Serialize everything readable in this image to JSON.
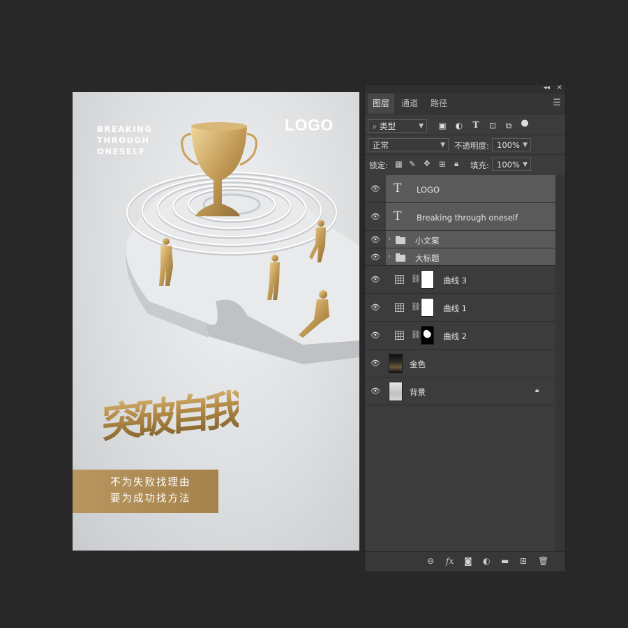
{
  "poster": {
    "en_slogan": [
      "BREAKING",
      "THROUGH",
      "ONESELF"
    ],
    "logo": "LOGO",
    "cn_title": "突破自我",
    "tagline": [
      "不为失败找理由",
      "要为成功找方法"
    ],
    "colors": {
      "gold": "#b8914f",
      "tagline_bg": "#b08c56",
      "canvas_bg": "#dcdee0"
    }
  },
  "panel": {
    "collapse_label": "◂◂",
    "close_label": "✕",
    "menu_icon": "hamburger-menu-icon",
    "tabs": [
      {
        "label": "图层",
        "active": true
      },
      {
        "label": "通道",
        "active": false
      },
      {
        "label": "路径",
        "active": false
      }
    ],
    "filter": {
      "search_glyph": "⌕",
      "kind_label": "类型"
    },
    "blend_mode": "正常",
    "opacity_label": "不透明度:",
    "opacity_value": "100%",
    "lock_label": "锁定:",
    "fill_label": "填充:",
    "fill_value": "100%",
    "layers": [
      {
        "name": "LOGO",
        "kind": "text",
        "selected": true
      },
      {
        "name": "Breaking through oneself",
        "kind": "text",
        "selected": true
      },
      {
        "name": "小文案",
        "kind": "group",
        "selected": true
      },
      {
        "name": "大标题",
        "kind": "group",
        "selected": true
      },
      {
        "name": "曲线 3",
        "kind": "curves",
        "mask": "white"
      },
      {
        "name": "曲线 1",
        "kind": "curves",
        "mask": "white"
      },
      {
        "name": "曲线 2",
        "kind": "curves",
        "mask": "dark"
      },
      {
        "name": "金色",
        "kind": "pixel"
      },
      {
        "name": "背景",
        "kind": "background",
        "locked": true
      }
    ],
    "footer_icons": [
      "link-layers-icon",
      "fx-icon",
      "add-mask-icon",
      "adjustment-layer-icon",
      "new-group-icon",
      "new-layer-icon",
      "delete-layer-icon"
    ]
  }
}
